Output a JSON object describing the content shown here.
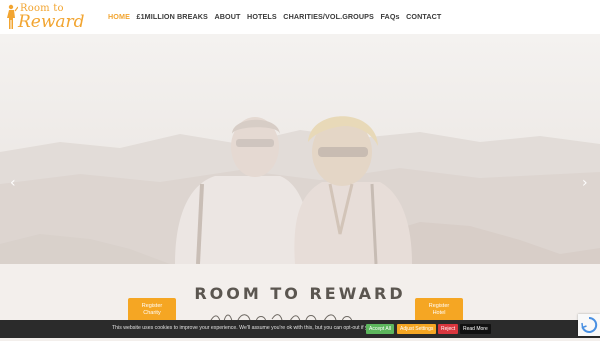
{
  "brand": {
    "line1": "Room to",
    "line2": "Reward",
    "color": "#f2a531"
  },
  "nav": {
    "items": [
      {
        "label": "HOME",
        "active": true
      },
      {
        "label": "£1MILLION BREAKS"
      },
      {
        "label": "ABOUT"
      },
      {
        "label": "HOTELS"
      },
      {
        "label": "CHARITIES/VOL.GROUPS"
      },
      {
        "label": "FAQs"
      },
      {
        "label": "CONTACT"
      }
    ]
  },
  "hero": {
    "prev_icon": "‹",
    "next_icon": "›"
  },
  "main": {
    "title": "ROOM TO REWARD",
    "register_charity": {
      "line1": "Register",
      "line2": "Charity"
    },
    "register_hotel": {
      "line1": "Register",
      "line2": "Hotel"
    }
  },
  "cookie": {
    "text": "This website uses cookies to improve your experience. We'll assume you're ok with this, but you can opt-out if you wish.",
    "accept_all": "Accept All",
    "settings": "Adjust Settings",
    "reject": "Reject",
    "read_more": "Read More"
  },
  "colors": {
    "accent": "#f5a623",
    "accept": "#5db65d",
    "reject": "#d9363e",
    "dark": "#2b2b2b"
  }
}
